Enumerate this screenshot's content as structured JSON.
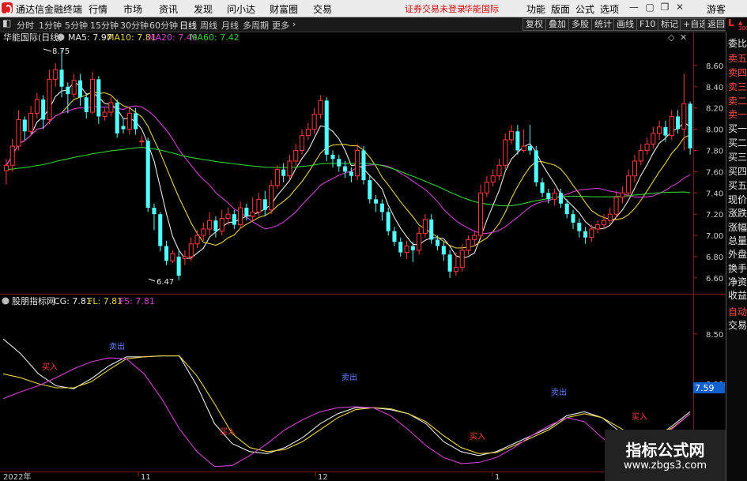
{
  "app": {
    "name": "通达信金融终端"
  },
  "menu": [
    "行情",
    "市场",
    "资讯",
    "发现",
    "问小达",
    "财富圈",
    "交易"
  ],
  "warning": [
    "证券交易未登录",
    "华能国际"
  ],
  "toolbar_right": [
    "功能",
    "版面",
    "公式",
    "选项",
    "游客"
  ],
  "periods": [
    "分时",
    "1分钟",
    "5分钟",
    "15分钟",
    "30分钟",
    "60分钟",
    "日线",
    "周线",
    "月线",
    "多周期",
    "更多"
  ],
  "period_active": "日线",
  "right_buttons": [
    "复权",
    "叠加",
    "多股",
    "统计",
    "画线",
    "F10",
    "标记",
    "+自选",
    "返回"
  ],
  "sidebar": {
    "badge": [
      "L",
      "300"
    ],
    "items": [
      "委比",
      "卖五",
      "卖四",
      "卖三",
      "卖二",
      "卖一",
      "买一",
      "买二",
      "买三",
      "买四",
      "买五",
      "现价",
      "涨跌",
      "涨幅",
      "总量",
      "外盘",
      "换手",
      "净资",
      "收益",
      "自动",
      "交易"
    ]
  },
  "main_chart": {
    "title": "华能国际(日线)",
    "ma_labels": [
      {
        "text": "MA5: 7.97",
        "color": "#e8e8e8"
      },
      {
        "text": "MA10: 7.81",
        "color": "#e8d040"
      },
      {
        "text": "MA20: 7.49",
        "color": "#d040d0"
      },
      {
        "text": "MA60: 7.42",
        "color": "#30d030"
      }
    ],
    "high_label": "8.75",
    "low_label": "6.47"
  },
  "sub_chart": {
    "title": "股朋指标网",
    "labels": [
      {
        "text": "CG: 7.81",
        "color": "#e8e8e8"
      },
      {
        "text": "FL: 7.81",
        "color": "#e8d040"
      },
      {
        "text": "FS: 7.81",
        "color": "#d040d0"
      }
    ],
    "current_value": "7.59",
    "buy_label": "买入",
    "sell_label": "卖出"
  },
  "x_axis": [
    "2022年",
    "11",
    "12",
    "1"
  ],
  "watermark": {
    "line1": "指标公式网",
    "line2": "www.zbgs3.com"
  },
  "chart_data": [
    {
      "type": "candlestick",
      "title": "华能国际(日线)",
      "ylim": [
        6.45,
        8.8
      ],
      "yticks": [
        6.6,
        6.8,
        7.0,
        7.2,
        7.4,
        7.6,
        7.8,
        8.0,
        8.2,
        8.4,
        8.6
      ],
      "ytick_labels": [
        "6.60",
        "6.80",
        "7.00",
        "7.20",
        "7.40",
        "7.60",
        "7.80",
        "8.00",
        "8.20",
        "8.40",
        "8.60"
      ],
      "candles": [
        [
          7.61,
          7.66,
          7.72,
          7.48
        ],
        [
          7.66,
          7.84,
          7.91,
          7.6
        ],
        [
          7.84,
          8.09,
          8.18,
          7.8
        ],
        [
          8.09,
          7.98,
          8.12,
          7.9
        ],
        [
          7.98,
          8.15,
          8.22,
          7.95
        ],
        [
          8.15,
          8.28,
          8.34,
          8.1
        ],
        [
          8.28,
          8.09,
          8.32,
          8.0
        ],
        [
          8.09,
          8.47,
          8.56,
          8.05
        ],
        [
          8.47,
          8.56,
          8.62,
          8.4
        ],
        [
          8.56,
          8.4,
          8.75,
          8.3
        ],
        [
          8.4,
          8.33,
          8.44,
          8.15
        ],
        [
          8.33,
          8.46,
          8.52,
          8.3
        ],
        [
          8.46,
          8.3,
          8.52,
          8.22
        ],
        [
          8.3,
          8.16,
          8.34,
          8.1
        ],
        [
          8.16,
          8.47,
          8.54,
          8.14
        ],
        [
          8.47,
          8.12,
          8.5,
          8.05
        ],
        [
          8.12,
          8.16,
          8.2,
          8.08
        ],
        [
          8.16,
          8.25,
          8.3,
          8.12
        ],
        [
          8.25,
          7.96,
          8.28,
          7.92
        ],
        [
          8.03,
          8.0,
          8.1,
          7.96
        ],
        [
          8.0,
          8.15,
          8.2,
          7.95
        ],
        [
          8.15,
          8.0,
          8.2,
          7.95
        ],
        [
          7.88,
          7.89,
          7.94,
          7.84
        ],
        [
          7.89,
          7.26,
          7.92,
          7.22
        ],
        [
          7.26,
          7.2,
          7.3,
          7.05
        ],
        [
          7.2,
          6.9,
          7.22,
          6.85
        ],
        [
          6.9,
          6.76,
          6.95,
          6.72
        ],
        [
          6.76,
          6.83,
          6.86,
          6.74
        ],
        [
          6.8,
          6.62,
          6.85,
          6.58
        ],
        [
          6.78,
          6.8,
          6.86,
          6.72
        ],
        [
          6.8,
          6.92,
          6.98,
          6.76
        ],
        [
          6.92,
          7.0,
          7.05,
          6.88
        ],
        [
          7.0,
          7.06,
          7.12,
          6.95
        ],
        [
          7.06,
          7.14,
          7.22,
          7.0
        ],
        [
          7.14,
          7.04,
          7.18,
          6.98
        ],
        [
          7.04,
          7.16,
          7.24,
          7.0
        ],
        [
          7.16,
          7.2,
          7.26,
          7.1
        ],
        [
          7.2,
          7.1,
          7.24,
          7.06
        ],
        [
          7.1,
          7.26,
          7.32,
          7.06
        ],
        [
          7.26,
          7.18,
          7.3,
          7.14
        ],
        [
          7.18,
          7.22,
          7.36,
          7.14
        ],
        [
          7.22,
          7.34,
          7.4,
          7.18
        ],
        [
          7.34,
          7.24,
          7.42,
          7.18
        ],
        [
          7.24,
          7.47,
          7.52,
          7.2
        ],
        [
          7.47,
          7.62,
          7.66,
          7.44
        ],
        [
          7.62,
          7.56,
          7.68,
          7.5
        ],
        [
          7.56,
          7.7,
          7.76,
          7.52
        ],
        [
          7.7,
          7.8,
          7.86,
          7.66
        ],
        [
          7.8,
          7.94,
          8.0,
          7.76
        ],
        [
          7.94,
          8.0,
          8.06,
          7.9
        ],
        [
          8.0,
          8.14,
          8.2,
          7.96
        ],
        [
          8.14,
          8.27,
          8.32,
          8.1
        ],
        [
          8.27,
          7.76,
          8.3,
          7.7
        ],
        [
          7.76,
          7.72,
          7.8,
          7.64
        ],
        [
          7.72,
          7.65,
          7.76,
          7.6
        ],
        [
          7.65,
          7.6,
          7.7,
          7.54
        ],
        [
          7.6,
          7.56,
          7.64,
          7.5
        ],
        [
          7.56,
          7.8,
          7.86,
          7.52
        ],
        [
          7.8,
          7.52,
          7.84,
          7.48
        ],
        [
          7.52,
          7.34,
          7.56,
          7.3
        ],
        [
          7.34,
          7.3,
          7.38,
          7.22
        ],
        [
          7.3,
          7.22,
          7.34,
          7.14
        ],
        [
          7.22,
          7.04,
          7.26,
          7.0
        ],
        [
          7.04,
          6.94,
          7.08,
          6.9
        ],
        [
          6.94,
          6.84,
          6.98,
          6.8
        ],
        [
          6.84,
          6.9,
          6.95,
          6.78
        ],
        [
          6.9,
          6.86,
          6.94,
          6.75
        ],
        [
          6.86,
          7.02,
          7.08,
          6.82
        ],
        [
          7.02,
          7.15,
          7.2,
          6.98
        ],
        [
          7.15,
          6.96,
          7.2,
          6.92
        ],
        [
          6.96,
          6.9,
          7.0,
          6.86
        ],
        [
          6.9,
          6.82,
          6.94,
          6.76
        ],
        [
          6.82,
          6.66,
          6.86,
          6.6
        ],
        [
          6.66,
          6.7,
          6.84,
          6.62
        ],
        [
          6.7,
          6.86,
          6.92,
          6.66
        ],
        [
          6.86,
          6.96,
          7.0,
          6.82
        ],
        [
          6.96,
          7.0,
          7.04,
          6.9
        ],
        [
          7.0,
          7.4,
          7.48,
          6.96
        ],
        [
          7.4,
          7.5,
          7.56,
          7.36
        ],
        [
          7.5,
          7.56,
          7.62,
          7.46
        ],
        [
          7.56,
          7.66,
          7.72,
          7.52
        ],
        [
          7.66,
          7.9,
          7.96,
          7.62
        ],
        [
          7.9,
          7.98,
          8.04,
          7.86
        ],
        [
          7.98,
          7.8,
          8.04,
          7.76
        ],
        [
          7.8,
          7.84,
          8.0,
          7.78
        ],
        [
          7.84,
          7.8,
          8.04,
          7.76
        ],
        [
          7.8,
          7.5,
          7.84,
          7.46
        ],
        [
          7.5,
          7.4,
          7.54,
          7.36
        ],
        [
          7.4,
          7.34,
          7.44,
          7.3
        ],
        [
          7.34,
          7.4,
          7.44,
          7.28
        ],
        [
          7.4,
          7.3,
          7.44,
          7.26
        ],
        [
          7.3,
          7.2,
          7.34,
          7.16
        ],
        [
          7.2,
          7.12,
          7.24,
          7.06
        ],
        [
          7.12,
          7.04,
          7.16,
          6.98
        ],
        [
          7.04,
          6.98,
          7.08,
          6.92
        ],
        [
          6.98,
          7.06,
          7.1,
          6.94
        ],
        [
          7.06,
          7.1,
          7.14,
          7.02
        ],
        [
          7.1,
          7.14,
          7.2,
          7.06
        ],
        [
          7.14,
          7.2,
          7.26,
          7.1
        ],
        [
          7.2,
          7.36,
          7.42,
          7.16
        ],
        [
          7.36,
          7.4,
          7.46,
          7.3
        ],
        [
          7.4,
          7.56,
          7.62,
          7.36
        ],
        [
          7.56,
          7.7,
          7.76,
          7.5
        ],
        [
          7.7,
          7.8,
          7.86,
          7.66
        ],
        [
          7.8,
          7.86,
          7.92,
          7.76
        ],
        [
          7.86,
          7.96,
          8.02,
          7.82
        ],
        [
          7.96,
          8.02,
          8.08,
          7.9
        ],
        [
          8.02,
          7.94,
          8.08,
          7.88
        ],
        [
          7.94,
          8.12,
          8.18,
          7.9
        ],
        [
          8.12,
          8.0,
          8.18,
          7.96
        ],
        [
          8.0,
          8.24,
          8.52,
          7.8
        ],
        [
          8.24,
          7.82,
          8.26,
          7.76
        ]
      ]
    },
    {
      "type": "line",
      "title": "股朋指标网",
      "ylim": [
        7.12,
        8.72
      ],
      "yticks": [
        7.5,
        8.0,
        8.5
      ],
      "ytick_labels": [
        "7.50",
        "8.00",
        "8.50"
      ],
      "series": [
        {
          "name": "CG",
          "color": "#e8e8e8",
          "values": [
            8.45,
            8.3,
            8.1,
            7.98,
            7.95,
            8.05,
            8.18,
            8.27,
            8.27,
            8.28,
            8.28,
            7.98,
            7.6,
            7.4,
            7.32,
            7.3,
            7.36,
            7.46,
            7.6,
            7.7,
            7.76,
            7.76,
            7.74,
            7.7,
            7.6,
            7.42,
            7.32,
            7.28,
            7.32,
            7.4,
            7.48,
            7.56,
            7.68,
            7.72,
            7.66,
            7.52,
            7.38,
            7.45,
            7.58,
            7.72
          ]
        },
        {
          "name": "FL",
          "color": "#e8d040",
          "values": [
            8.1,
            8.06,
            8.0,
            7.96,
            7.96,
            8.02,
            8.14,
            8.25,
            8.27,
            8.28,
            8.28,
            8.08,
            7.8,
            7.5,
            7.36,
            7.32,
            7.34,
            7.42,
            7.54,
            7.66,
            7.74,
            7.76,
            7.75,
            7.7,
            7.62,
            7.48,
            7.36,
            7.3,
            7.31,
            7.38,
            7.46,
            7.54,
            7.66,
            7.7,
            7.66,
            7.56,
            7.45,
            7.46,
            7.56,
            7.7
          ]
        },
        {
          "name": "FS",
          "color": "#d040d0",
          "values": [
            7.85,
            7.92,
            7.98,
            8.06,
            8.15,
            8.22,
            8.26,
            8.25,
            8.1,
            7.85,
            7.55,
            7.32,
            7.17,
            7.18,
            7.28,
            7.4,
            7.54,
            7.64,
            7.72,
            7.76,
            7.77,
            7.76,
            7.68,
            7.54,
            7.38,
            7.26,
            7.2,
            7.21,
            7.26,
            7.36,
            7.48,
            7.58,
            7.66,
            7.62,
            7.46,
            7.32,
            7.3,
            7.42,
            7.55,
            7.7
          ]
        }
      ]
    }
  ]
}
